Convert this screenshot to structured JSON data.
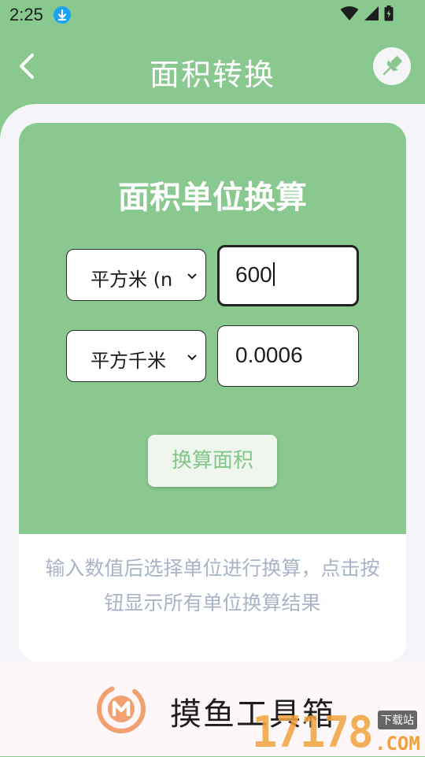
{
  "status_bar": {
    "time": "2:25"
  },
  "header": {
    "title": "面积转换"
  },
  "card": {
    "title": "面积单位换算",
    "from": {
      "unit": "平方米 (n",
      "value": "600"
    },
    "to": {
      "unit": "平方千米",
      "value": "0.0006"
    },
    "convert_label": "换算面积",
    "hint": "输入数值后选择单位进行换算，点击按钮显示所有单位换算结果"
  },
  "footer": {
    "app_name": "摸鱼工具箱",
    "watermark": "17178",
    "watermark_badge": "下载站",
    "watermark_com": ".COM"
  },
  "colors": {
    "accent": "#89c98f",
    "button_text": "#84c689",
    "hint_text": "#a9b4c6"
  }
}
